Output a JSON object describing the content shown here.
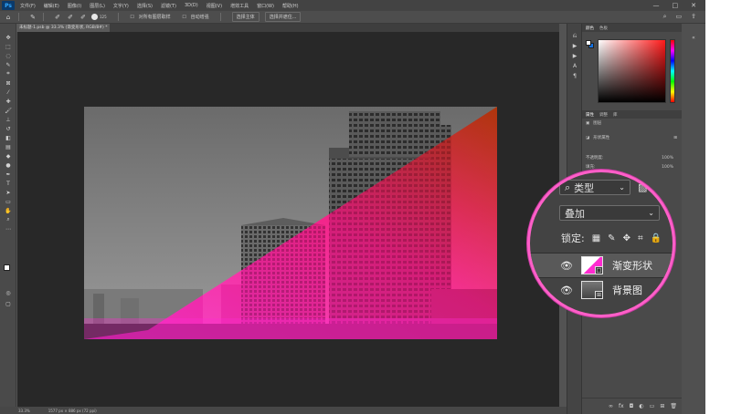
{
  "menubar": {
    "items": [
      "文件(F)",
      "编辑(E)",
      "图像(I)",
      "图层(L)",
      "文字(Y)",
      "选择(S)",
      "滤镜(T)",
      "3D(D)",
      "视图(V)",
      "增效工具",
      "窗口(W)",
      "帮助(H)"
    ],
    "window_controls": [
      "—",
      "□",
      "✕"
    ]
  },
  "options_bar": {
    "brush_size": "125",
    "checkbox_label": "对所有图层取样",
    "auto_enhance": "自动增强",
    "select_subject": "选择主体",
    "select_and_mask": "选择并遮住..."
  },
  "document": {
    "tab_title": "未标题-1.psb @ 33.3% (渐变形状, RGB/8#) *"
  },
  "status_bar": {
    "zoom": "33.3%",
    "doc_info": "1577 px × 886 px (72 ppi)"
  },
  "color_panel": {
    "tabs": [
      "颜色",
      "色板"
    ]
  },
  "properties_panel": {
    "tabs": [
      "属性",
      "调整",
      "库"
    ],
    "rows": [
      "图层",
      "形状属性"
    ],
    "opacity_label": "不透明度:",
    "opacity_value": "100%",
    "fill_label": "填充:",
    "fill_value": "100%"
  },
  "layers_panel": {
    "filter_label": "类型",
    "blend_mode": "叠加",
    "lock_label": "锁定:",
    "layers": [
      {
        "name": "渐变形状",
        "visible": true,
        "selected": true
      },
      {
        "name": "背景图",
        "visible": true,
        "selected": false
      }
    ]
  },
  "colors": {
    "accent_ring": "#ff5fc8",
    "gradient_start": "#ff1fc1",
    "gradient_end": "#b83000"
  }
}
